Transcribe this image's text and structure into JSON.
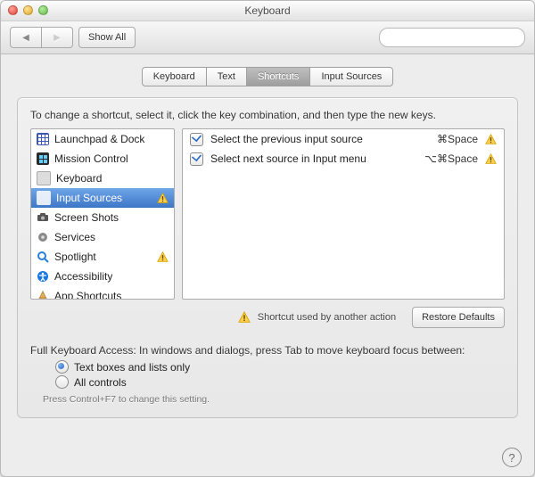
{
  "window": {
    "title": "Keyboard"
  },
  "toolbar": {
    "back": "◀",
    "fwd": "▶",
    "show_all": "Show All",
    "search_placeholder": ""
  },
  "tabs": [
    "Keyboard",
    "Text",
    "Shortcuts",
    "Input Sources"
  ],
  "active_tab": 2,
  "instruction": "To change a shortcut, select it, click the key combination, and then type the new keys.",
  "categories": [
    {
      "label": "Launchpad & Dock",
      "icon": "launchpad",
      "warn": false
    },
    {
      "label": "Mission Control",
      "icon": "mission",
      "warn": false
    },
    {
      "label": "Keyboard",
      "icon": "keyboard",
      "warn": false
    },
    {
      "label": "Input Sources",
      "icon": "input",
      "warn": true,
      "selected": true
    },
    {
      "label": "Screen Shots",
      "icon": "screen",
      "warn": false
    },
    {
      "label": "Services",
      "icon": "services",
      "warn": false
    },
    {
      "label": "Spotlight",
      "icon": "spotlight",
      "warn": true
    },
    {
      "label": "Accessibility",
      "icon": "access",
      "warn": false
    },
    {
      "label": "App Shortcuts",
      "icon": "app",
      "warn": false
    }
  ],
  "shortcuts": [
    {
      "checked": true,
      "label": "Select the previous input source",
      "combo": "⌘Space",
      "warn": true
    },
    {
      "checked": true,
      "label": "Select next source in Input menu",
      "combo": "⌥⌘Space",
      "warn": true
    }
  ],
  "legend": "Shortcut used by another action",
  "restore": "Restore Defaults",
  "fka": {
    "label": "Full Keyboard Access: In windows and dialogs, press Tab to move keyboard focus between:",
    "opt1": "Text boxes and lists only",
    "opt2": "All controls",
    "selected": 0,
    "hint": "Press Control+F7 to change this setting."
  }
}
